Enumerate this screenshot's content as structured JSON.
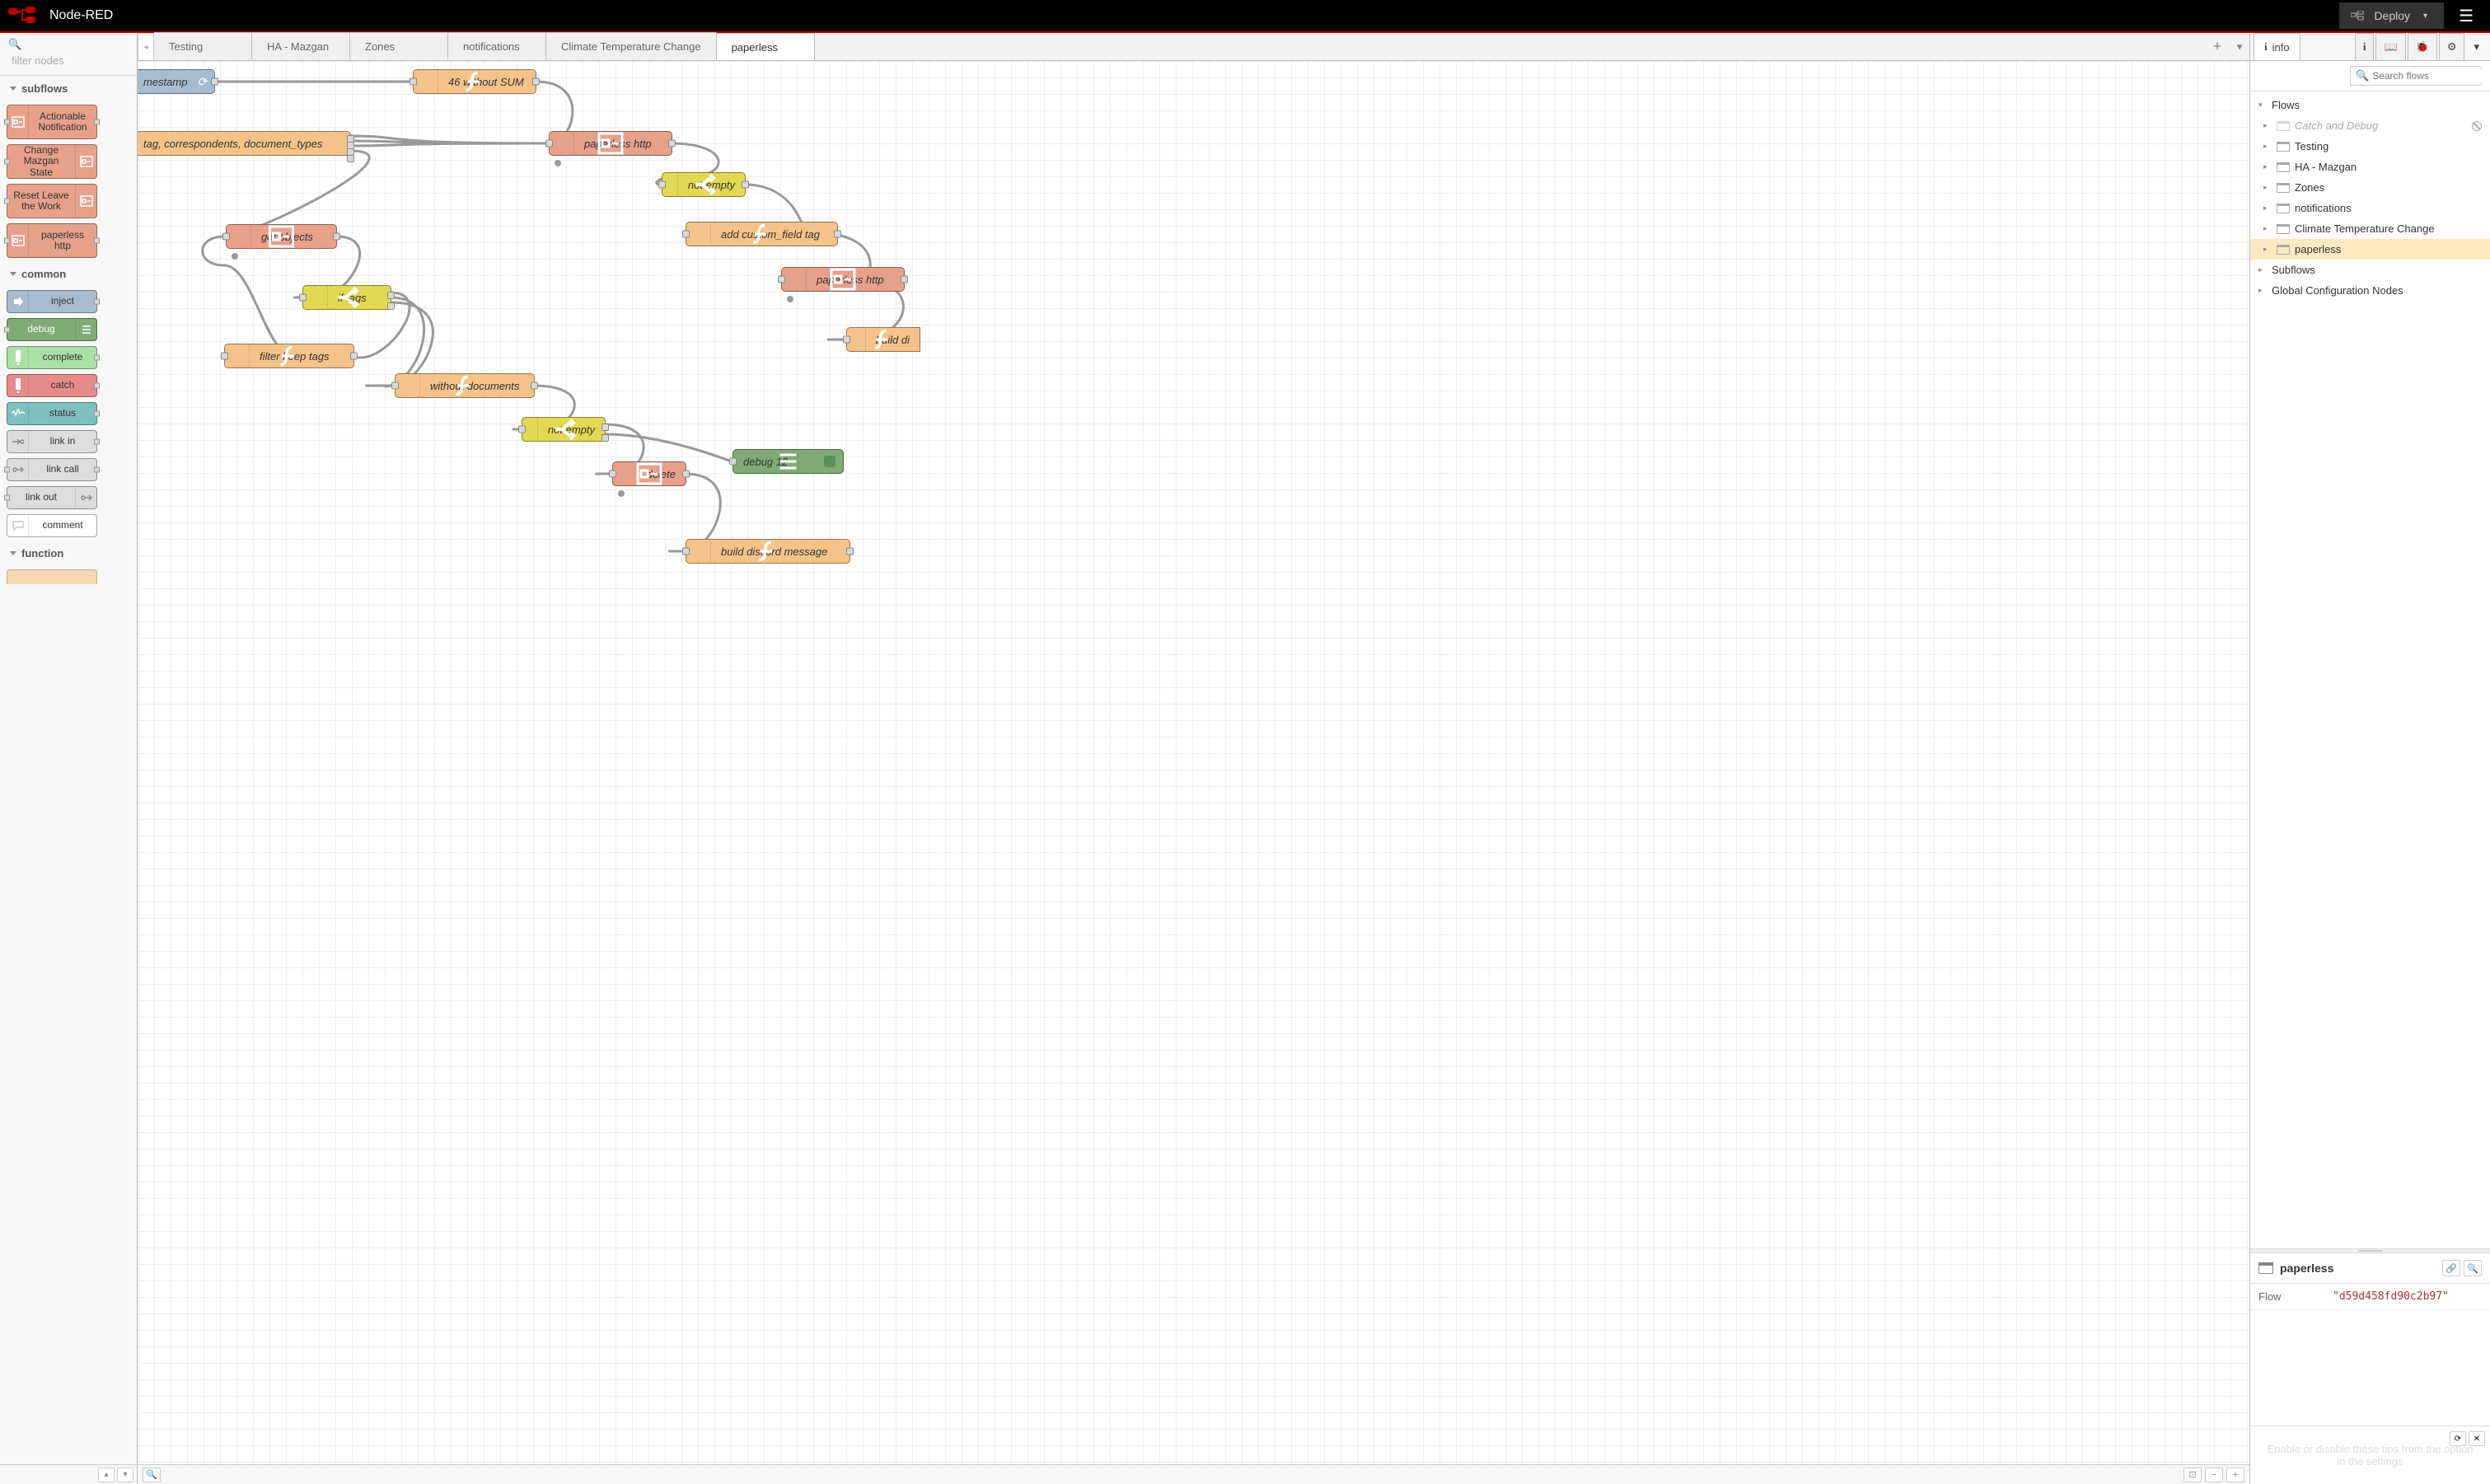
{
  "header": {
    "title": "Node-RED",
    "deploy": "Deploy"
  },
  "palette": {
    "filter_placeholder": "filter nodes",
    "cat_subflows": "subflows",
    "cat_common": "common",
    "cat_function": "function",
    "subflows": [
      {
        "label": "Actionable Notification"
      },
      {
        "label": "Change Mazgan State"
      },
      {
        "label": "Reset Leave the Work"
      },
      {
        "label": "paperless http"
      }
    ],
    "common": {
      "inject": "inject",
      "debug": "debug",
      "complete": "complete",
      "catch": "catch",
      "status": "status",
      "link_in": "link in",
      "link_call": "link call",
      "link_out": "link out",
      "comment": "comment"
    }
  },
  "tabs": [
    "Testing",
    "HA - Mazgan",
    "Zones",
    "notifications",
    "Climate Temperature Change",
    "paperless"
  ],
  "active_tab": 5,
  "nodes": {
    "timestamp": {
      "label": "mestamp"
    },
    "fn_46": {
      "label": "46 without SUM"
    },
    "tag_corr": {
      "label": "tag, correspondents, document_types"
    },
    "paperless1": {
      "label": "paperless http"
    },
    "notempty1": {
      "label": "not empty"
    },
    "get_objects": {
      "label": "get objects"
    },
    "add_cf": {
      "label": "add custom_field tag"
    },
    "if_tags": {
      "label": "if tags"
    },
    "paperless2": {
      "label": "paperless http"
    },
    "filter_keep": {
      "label": "filter keep tags"
    },
    "build_di": {
      "label": "build di"
    },
    "without_docs": {
      "label": "without documents"
    },
    "notempty2": {
      "label": "not empty"
    },
    "delete": {
      "label": "delete"
    },
    "debug12": {
      "label": "debug 12"
    },
    "build_discord": {
      "label": "build discord message"
    }
  },
  "sidebar": {
    "info_tab": "info",
    "search_placeholder": "Search flows",
    "tree": {
      "flows_label": "Flows",
      "subflows_label": "Subflows",
      "global_label": "Global Configuration Nodes",
      "flows": [
        {
          "label": "Catch and Debug",
          "disabled": true
        },
        {
          "label": "Testing"
        },
        {
          "label": "HA - Mazgan"
        },
        {
          "label": "Zones"
        },
        {
          "label": "notifications"
        },
        {
          "label": "Climate Temperature Change",
          "ellipsis": "Climate Temperature Change"
        },
        {
          "label": "paperless",
          "selected": true
        }
      ]
    },
    "info": {
      "title": "paperless",
      "prop_key": "Flow",
      "prop_val": "\"d59d458fd90c2b97\""
    },
    "tips": "Enable or disable these tips from the option in the settings"
  }
}
